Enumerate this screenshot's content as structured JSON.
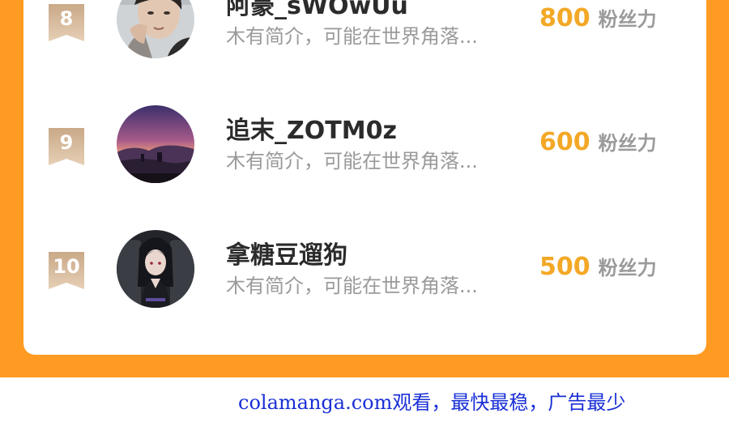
{
  "colors": {
    "background": "#ff9a22",
    "fans_count": "#f3a826",
    "badge": "#d9b896",
    "watermark": "#1a2fd6"
  },
  "ranking": {
    "entries": [
      {
        "rank": "8",
        "name": "阿豪_sWOwUu",
        "intro": "木有简介，可能在世界角落...",
        "fans_count": "800",
        "fans_unit": "粉丝力",
        "avatar": "avatar-man-photo"
      },
      {
        "rank": "9",
        "name": "追末_ZOTM0z",
        "intro": "木有简介，可能在世界角落...",
        "fans_count": "600",
        "fans_unit": "粉丝力",
        "avatar": "avatar-dusk-landscape"
      },
      {
        "rank": "10",
        "name": "拿糖豆遛狗",
        "intro": "木有简介，可能在世界角落...",
        "fans_count": "500",
        "fans_unit": "粉丝力",
        "avatar": "avatar-anime-character"
      }
    ]
  },
  "footer": {
    "watermark": "colamanga.com观看，最快最稳，广告最少"
  }
}
